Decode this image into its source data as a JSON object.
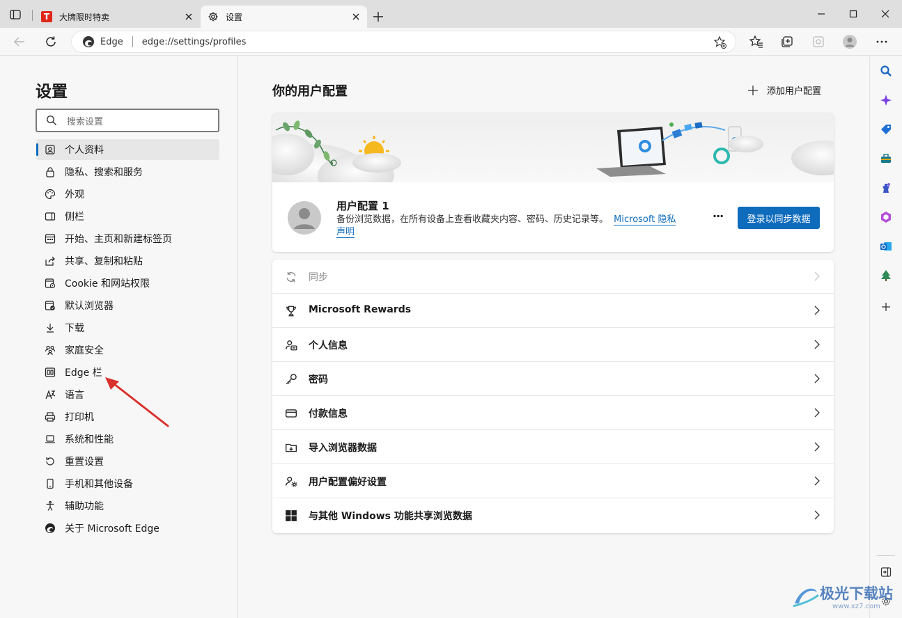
{
  "tabs": [
    {
      "title": "大牌限时特卖",
      "favicon_letter": "T",
      "favicon_color": "#e1251b"
    },
    {
      "title": "设置"
    }
  ],
  "address": {
    "site_name": "Edge",
    "url": "edge://settings/profiles"
  },
  "leftnav": {
    "title": "设置",
    "search_placeholder": "搜索设置",
    "items": [
      {
        "label": "个人资料",
        "icon": "profile-icon",
        "active": true
      },
      {
        "label": "隐私、搜索和服务",
        "icon": "lock-icon"
      },
      {
        "label": "外观",
        "icon": "palette-icon"
      },
      {
        "label": "侧栏",
        "icon": "sidebar-icon"
      },
      {
        "label": "开始、主页和新建标签页",
        "icon": "home-tiles-icon"
      },
      {
        "label": "共享、复制和粘贴",
        "icon": "share-icon"
      },
      {
        "label": "Cookie 和网站权限",
        "icon": "cookie-icon"
      },
      {
        "label": "默认浏览器",
        "icon": "browser-icon"
      },
      {
        "label": "下载",
        "icon": "download-icon"
      },
      {
        "label": "家庭安全",
        "icon": "family-icon"
      },
      {
        "label": "Edge 栏",
        "icon": "edge-bar-icon"
      },
      {
        "label": "语言",
        "icon": "language-icon"
      },
      {
        "label": "打印机",
        "icon": "printer-icon"
      },
      {
        "label": "系统和性能",
        "icon": "laptop-icon"
      },
      {
        "label": "重置设置",
        "icon": "reset-icon"
      },
      {
        "label": "手机和其他设备",
        "icon": "phone-icon"
      },
      {
        "label": "辅助功能",
        "icon": "accessibility-icon"
      },
      {
        "label": "关于 Microsoft Edge",
        "icon": "edge-logo-icon"
      }
    ]
  },
  "main": {
    "title": "你的用户配置",
    "add_profile_label": "添加用户配置",
    "profile": {
      "name": "用户配置 1",
      "desc": "备份浏览数据，在所有设备上查看收藏夹内容、密码、历史记录等。",
      "link_text_1": "Microsoft 隐私",
      "link_text_2": "声明",
      "more_label": "···",
      "sync_button_label": "登录以同步数据"
    },
    "rows": [
      {
        "label": "同步",
        "icon": "sync-icon",
        "disabled": true
      },
      {
        "label": "Microsoft Rewards",
        "icon": "trophy-icon"
      },
      {
        "label": "个人信息",
        "icon": "person-card-icon"
      },
      {
        "label": "密码",
        "icon": "key-icon"
      },
      {
        "label": "付款信息",
        "icon": "card-icon"
      },
      {
        "label": "导入浏览器数据",
        "icon": "import-icon"
      },
      {
        "label": "用户配置偏好设置",
        "icon": "profile-settings-icon"
      },
      {
        "label": "与其他 Windows 功能共享浏览数据",
        "icon": "windows-icon"
      }
    ]
  },
  "watermark": {
    "text": "极光下载站",
    "sub": "www.xz7.com"
  },
  "colors": {
    "accent": "#0f6cbd",
    "arrow": "#d9302c",
    "tab_bar": "#dfdfdf"
  }
}
